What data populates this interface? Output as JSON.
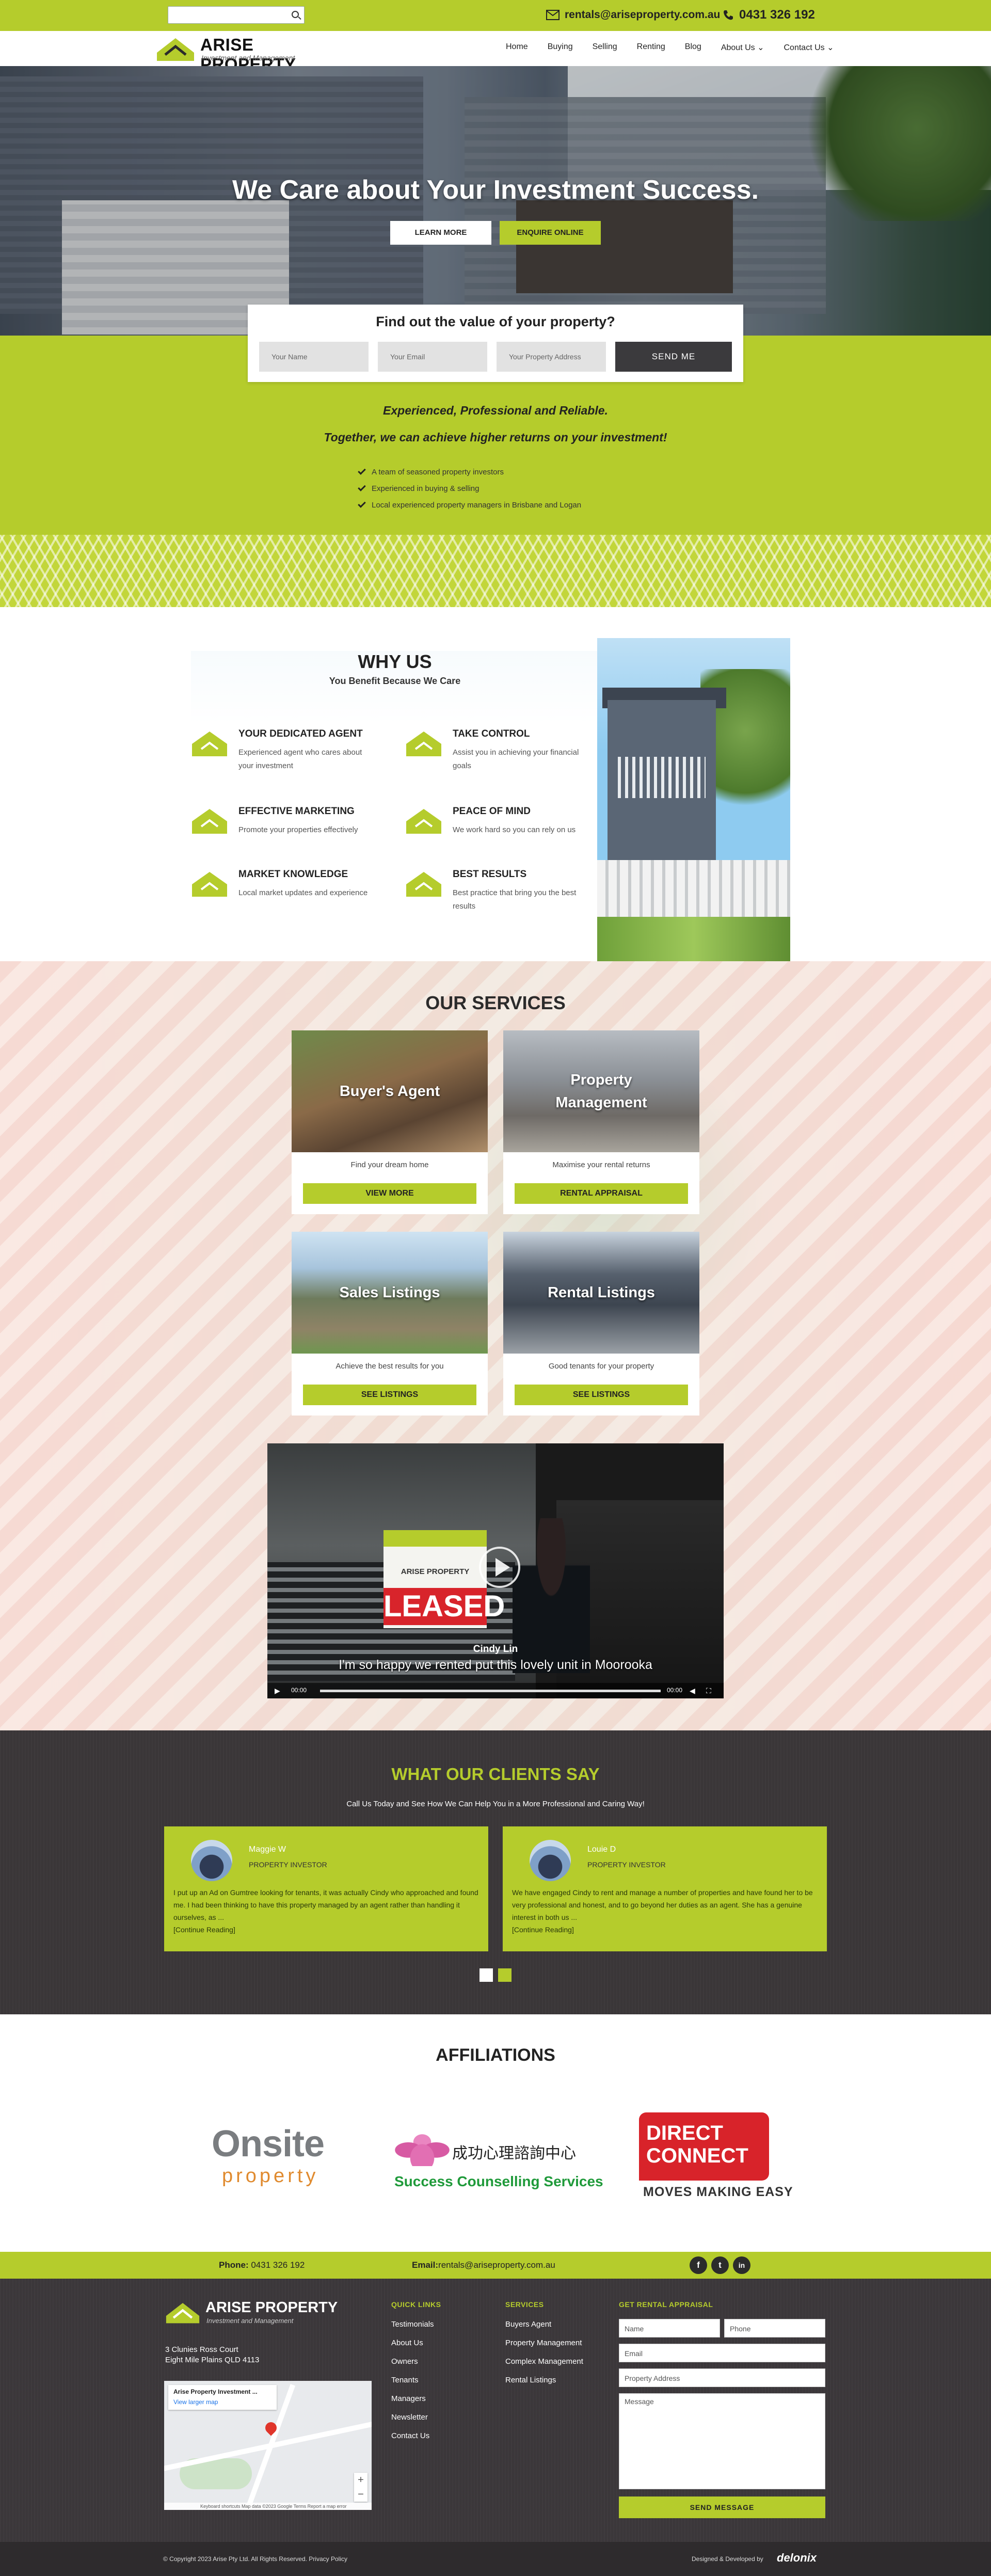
{
  "topbar": {
    "email": "rentals@ariseproperty.com.au",
    "phone": "0431 326 192"
  },
  "header": {
    "logo_title": "ARISE PROPERTY",
    "logo_subtitle": "Investment and Management",
    "nav": [
      "Home",
      "Buying",
      "Selling",
      "Renting",
      "Blog",
      "About Us",
      "Contact Us"
    ]
  },
  "hero": {
    "title": "We Care about Your Investment Success.",
    "learn_more": "LEARN MORE",
    "enquire": "ENQUIRE ONLINE"
  },
  "valuation": {
    "title": "Find out the value of your property?",
    "name_placeholder": "Your Name",
    "email_placeholder": "Your Email",
    "address_placeholder": "Your Property Address",
    "submit": "SEND ME"
  },
  "intro": {
    "line1": "Experienced, Professional and Reliable.",
    "line2": "Together, we can achieve higher returns on your investment!",
    "points": [
      "A team of seasoned property investors",
      "Experienced in buying & selling",
      "Local experienced property managers in Brisbane and Logan"
    ]
  },
  "why_us": {
    "title": "WHY US",
    "subtitle": "You Benefit Because We Care",
    "features": [
      {
        "title": "YOUR DEDICATED AGENT",
        "desc": "Experienced agent who cares about your investment"
      },
      {
        "title": "TAKE CONTROL",
        "desc": "Assist you in achieving your financial goals"
      },
      {
        "title": "EFFECTIVE MARKETING",
        "desc": "Promote your properties effectively"
      },
      {
        "title": "PEACE OF MIND",
        "desc": "We work hard so you can rely on us"
      },
      {
        "title": "MARKET KNOWLEDGE",
        "desc": "Local market updates and experience"
      },
      {
        "title": "BEST RESULTS",
        "desc": "Best practice that bring you the best results"
      }
    ]
  },
  "services": {
    "title": "OUR SERVICES",
    "cards": [
      {
        "name": "Buyer's Agent",
        "desc": "Find your dream home",
        "button": "VIEW MORE"
      },
      {
        "name": "Property Management",
        "desc": "Maximise your rental returns",
        "button": "RENTAL APPRAISAL"
      },
      {
        "name": "Sales Listings",
        "desc": "Achieve the best results for you",
        "button": "SEE LISTINGS"
      },
      {
        "name": "Rental Listings",
        "desc": "Good tenants for your property",
        "button": "SEE LISTINGS"
      }
    ],
    "video": {
      "speaker": "Cindy Lin",
      "caption": "I'm so happy we rented put this lovely unit in Moorooka",
      "sign_brand": "ARISE PROPERTY",
      "sign_text": "LEASED",
      "time_current": "00:00",
      "time_total": "00:00"
    }
  },
  "clients": {
    "title": "WHAT OUR CLIENTS SAY",
    "subtitle": "Call Us Today and See How We Can Help You in a More Professional and Caring Way!",
    "testimonials": [
      {
        "name": "Maggie W",
        "role": "PROPERTY INVESTOR",
        "text": "I put up an Ad on Gumtree looking for tenants, it was actually Cindy who approached and found me. I had been thinking to have this property managed by an agent rather than handling it ourselves, as ...",
        "more": "[Continue Reading]"
      },
      {
        "name": "Louie D",
        "role": "PROPERTY INVESTOR",
        "text": "We have engaged Cindy to rent and manage a number of properties and have found her to be very professional and honest, and to go beyond her duties as an agent. She has a genuine interest in both us ...",
        "more": "[Continue Reading]"
      }
    ],
    "dots": [
      "1",
      "2"
    ]
  },
  "affiliations": {
    "title": "AFFILIATIONS",
    "onsite_top": "Onsite",
    "onsite_bottom": "property",
    "success_cn": "成功心理諮詢中心",
    "success_en": "Success Counselling Services",
    "direct_connect": "DIRECT CONNECT",
    "direct_tagline": "MOVES MAKING EASY"
  },
  "contact_strip": {
    "phone_label": "Phone:",
    "phone": "0431 326 192",
    "email_label": "Email:",
    "email": "rentals@ariseproperty.com.au",
    "social": [
      "f",
      "t",
      "in"
    ]
  },
  "footer": {
    "logo_title": "ARISE PROPERTY",
    "logo_subtitle": "Investment and Management",
    "address_line1": "3 Clunies Ross Court",
    "address_line2": "Eight Mile Plains QLD 4113",
    "map_card_title": "Arise Property Investment ...",
    "map_card_link": "View larger map",
    "map_footer": "Keyboard shortcuts   Map data ©2023 Google   Terms   Report a map error",
    "quick_links_title": "QUICK LINKS",
    "quick_links": [
      "Testimonials",
      "About Us",
      "Owners",
      "Tenants",
      "Managers",
      "Newsletter",
      "Contact Us"
    ],
    "services_title": "SERVICES",
    "services": [
      "Buyers Agent",
      "Property Management",
      "Complex Management",
      "Rental Listings"
    ],
    "appraisal_title": "GET RENTAL APPRAISAL",
    "ph_name": "Name",
    "ph_phone": "Phone",
    "ph_email": "Email",
    "ph_address": "Property Address",
    "ph_message": "Message",
    "send": "SEND MESSAGE"
  },
  "bottom": {
    "copyright": "© Copyright 2023 Arise Pty Ltd. All Rights Reserved.  Privacy Policy",
    "designed": "Designed & Developed by",
    "developer": "delonix"
  },
  "colors": {
    "accent": "#b5cc2c",
    "dark": "#3b373a"
  }
}
